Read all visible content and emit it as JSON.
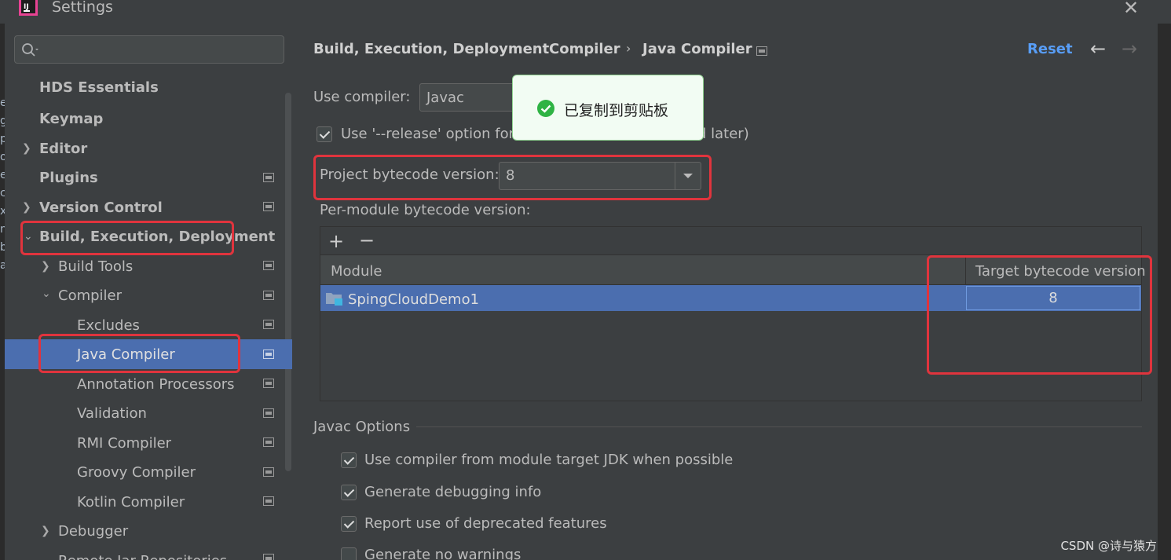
{
  "window": {
    "title": "Settings"
  },
  "colors": {
    "accent": "#4b6eaf",
    "highlight": "#e0343d",
    "link": "#589df6",
    "toast_bg": "#f2fcf3"
  },
  "left_strip": {
    "chars": [
      "e",
      "g",
      "p",
      "o",
      "e",
      "c",
      "x",
      "",
      "n",
      "b",
      "a"
    ]
  },
  "sidebar": {
    "search_placeholder": "",
    "items": [
      {
        "label": "HDS Essentials"
      },
      {
        "label": "Keymap"
      },
      {
        "label": "Editor"
      },
      {
        "label": "Plugins"
      },
      {
        "label": "Version Control"
      },
      {
        "label": "Build, Execution, Deployment"
      },
      {
        "label": "Build Tools"
      },
      {
        "label": "Compiler"
      },
      {
        "label": "Excludes"
      },
      {
        "label": "Java Compiler"
      },
      {
        "label": "Annotation Processors"
      },
      {
        "label": "Validation"
      },
      {
        "label": "RMI Compiler"
      },
      {
        "label": "Groovy Compiler"
      },
      {
        "label": "Kotlin Compiler"
      },
      {
        "label": "Debugger"
      },
      {
        "label": "Remote Jar Repositories"
      }
    ]
  },
  "breadcrumb": {
    "parts": [
      "Build, Execution, Deployment",
      "Compiler",
      "Java Compiler"
    ],
    "separator": "›"
  },
  "header": {
    "reset_label": "Reset",
    "back_icon": "←",
    "forward_icon": "→"
  },
  "compiler": {
    "use_compiler_label": "Use compiler:",
    "use_compiler_value": "Javac",
    "release_option_label": "Use '--release' option for",
    "release_option_suffix": "d later)",
    "project_bytecode_label": "Project bytecode version:",
    "project_bytecode_value": "8",
    "per_module_label": "Per-module bytecode version:"
  },
  "table": {
    "add_icon": "+",
    "remove_icon": "−",
    "columns": [
      "Module",
      "Target bytecode version"
    ],
    "rows": [
      {
        "module": "SpingCloudDemo1",
        "target": "8"
      }
    ]
  },
  "javac_options": {
    "title": "Javac Options",
    "options": [
      {
        "label": "Use compiler from module target JDK when possible",
        "checked": true
      },
      {
        "label": "Generate debugging info",
        "checked": true
      },
      {
        "label": "Report use of deprecated features",
        "checked": true
      },
      {
        "label": "Generate no warnings",
        "checked": false
      }
    ]
  },
  "toast": {
    "text": "已复制到剪贴板"
  },
  "watermark": "CSDN @诗与猿方"
}
